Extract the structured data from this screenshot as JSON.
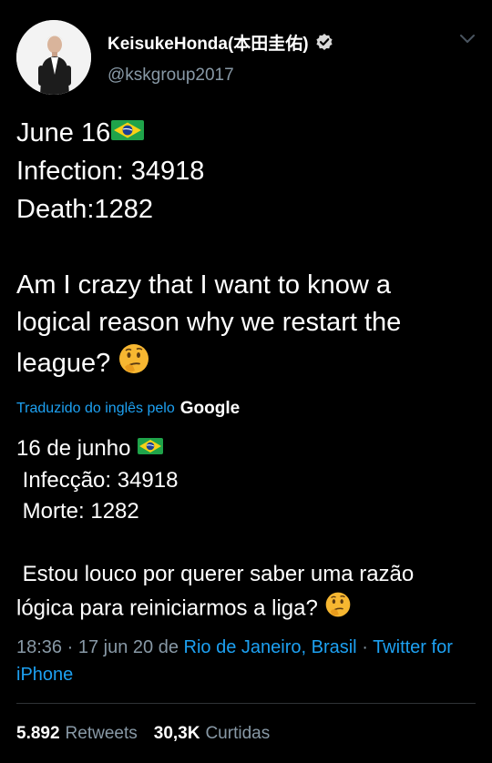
{
  "author": {
    "display_name": "KeisukeHonda(本田圭佑)",
    "handle": "@kskgroup2017",
    "avatar_icon": "profile-photo",
    "verified_icon": "verified-badge-icon",
    "menu_icon": "chevron-down-icon"
  },
  "tweet": {
    "line1": "June 16",
    "line1_emoji": "brazil-flag-emoji",
    "line2": "Infection: 34918",
    "line3": "Death:1282",
    "line4": "Am I crazy that I want to know a",
    "line5": "logical reason why we restart the",
    "line6": "league?",
    "line6_emoji": "thinking-face-emoji"
  },
  "translation": {
    "label": "Traduzido do inglês pelo",
    "provider": "Google",
    "line1": "16 de junho",
    "line1_emoji": "brazil-flag-emoji",
    "line2": " Infecção: 34918",
    "line3": " Morte: 1282",
    "line4": " Estou louco por querer saber uma razão",
    "line5": "lógica para reiniciarmos a liga?",
    "line5_emoji": "thinking-face-emoji"
  },
  "meta": {
    "time": "18:36",
    "date": "17 jun 20",
    "from_prefix": "de",
    "location": "Rio de Janeiro, Brasil",
    "client": "Twitter for iPhone"
  },
  "stats": {
    "retweets_count": "5.892",
    "retweets_label": "Retweets",
    "likes_count": "30,3K",
    "likes_label": "Curtidas"
  },
  "colors": {
    "background": "#000000",
    "text": "#ffffff",
    "secondary": "#8899a6",
    "link": "#1da1f2",
    "verified": "#d9d9d9"
  }
}
